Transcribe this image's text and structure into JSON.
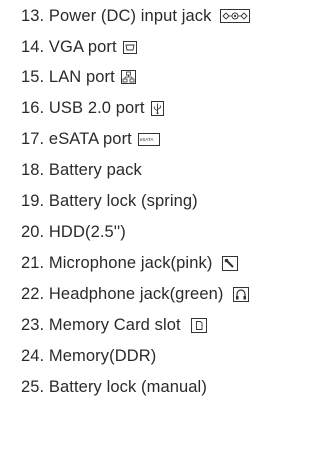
{
  "items": [
    {
      "label": "13. Power (DC) input jack",
      "icon": "dc-power-icon"
    },
    {
      "label": "14. VGA port",
      "icon": "vga-icon"
    },
    {
      "label": "15. LAN port",
      "icon": "lan-icon"
    },
    {
      "label": "16. USB 2.0 port",
      "icon": "usb-icon"
    },
    {
      "label": "17. eSATA port",
      "icon": "esata-icon",
      "icon_text": "eSATA"
    },
    {
      "label": "18. Battery pack"
    },
    {
      "label": "19. Battery lock (spring)"
    },
    {
      "label": "20. HDD(2.5'')"
    },
    {
      "label": "21. Microphone jack(pink)",
      "icon": "microphone-icon"
    },
    {
      "label": "22. Headphone jack(green)",
      "icon": "headphone-icon"
    },
    {
      "label": "23. Memory Card slot",
      "icon": "memory-card-icon"
    },
    {
      "label": "24. Memory(DDR)"
    },
    {
      "label": "25. Battery lock (manual)"
    }
  ]
}
